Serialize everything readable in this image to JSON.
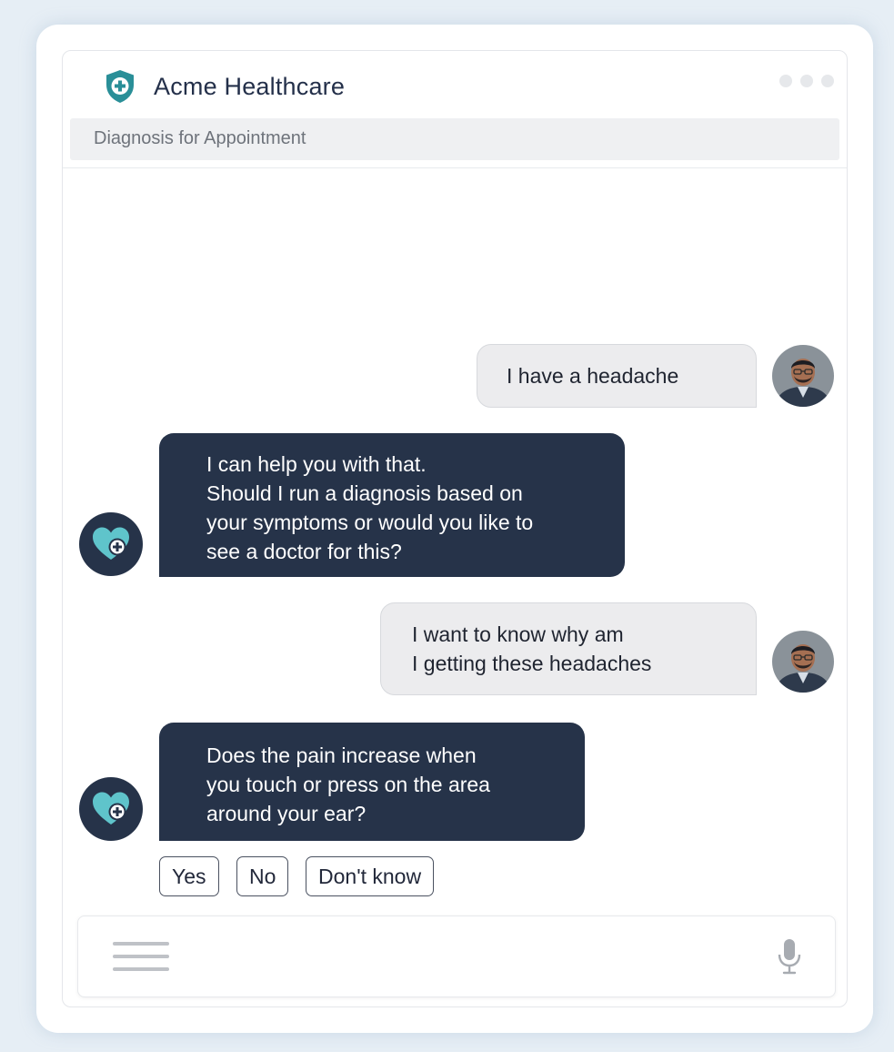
{
  "app": {
    "title": "Acme Healthcare",
    "subtitle": "Diagnosis for Appointment"
  },
  "colors": {
    "accent": "#2a8f98",
    "bot_bubble": "#263349",
    "user_bubble": "#ececee",
    "page_background": "#e6eef5"
  },
  "icons": {
    "brand": "shield-plus-icon",
    "window_menu": "more-dots-icon",
    "bot_avatar": "heart-plus-icon",
    "composer_menu": "hamburger-menu-icon",
    "composer_voice": "microphone-icon"
  },
  "messages": [
    {
      "sender": "user",
      "lines": [
        "I have a headache"
      ]
    },
    {
      "sender": "bot",
      "lines": [
        "I can help you with that.",
        "Should I run a diagnosis based on",
        "your symptoms or would you like to",
        "see a doctor for this?"
      ]
    },
    {
      "sender": "user",
      "lines": [
        "I want to know why am",
        "I getting these headaches"
      ]
    },
    {
      "sender": "bot",
      "lines": [
        "Does the pain increase when",
        "you touch or press on the area",
        "around your ear?"
      ]
    }
  ],
  "quick_replies": [
    "Yes",
    "No",
    "Don't know"
  ]
}
